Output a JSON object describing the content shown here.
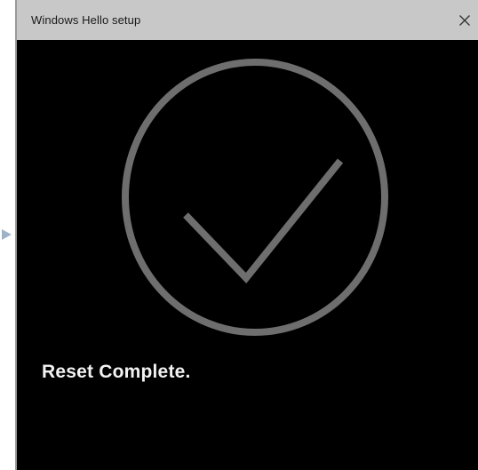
{
  "window": {
    "title": "Windows Hello setup",
    "close_icon": "close-icon"
  },
  "content": {
    "status_icon": "checkmark-circle-icon",
    "status_text": "Reset Complete."
  },
  "colors": {
    "background": "#000000",
    "titlebar": "#c8c8c8",
    "graphic": "#6e6e6e",
    "text": "#f2f2f2"
  }
}
